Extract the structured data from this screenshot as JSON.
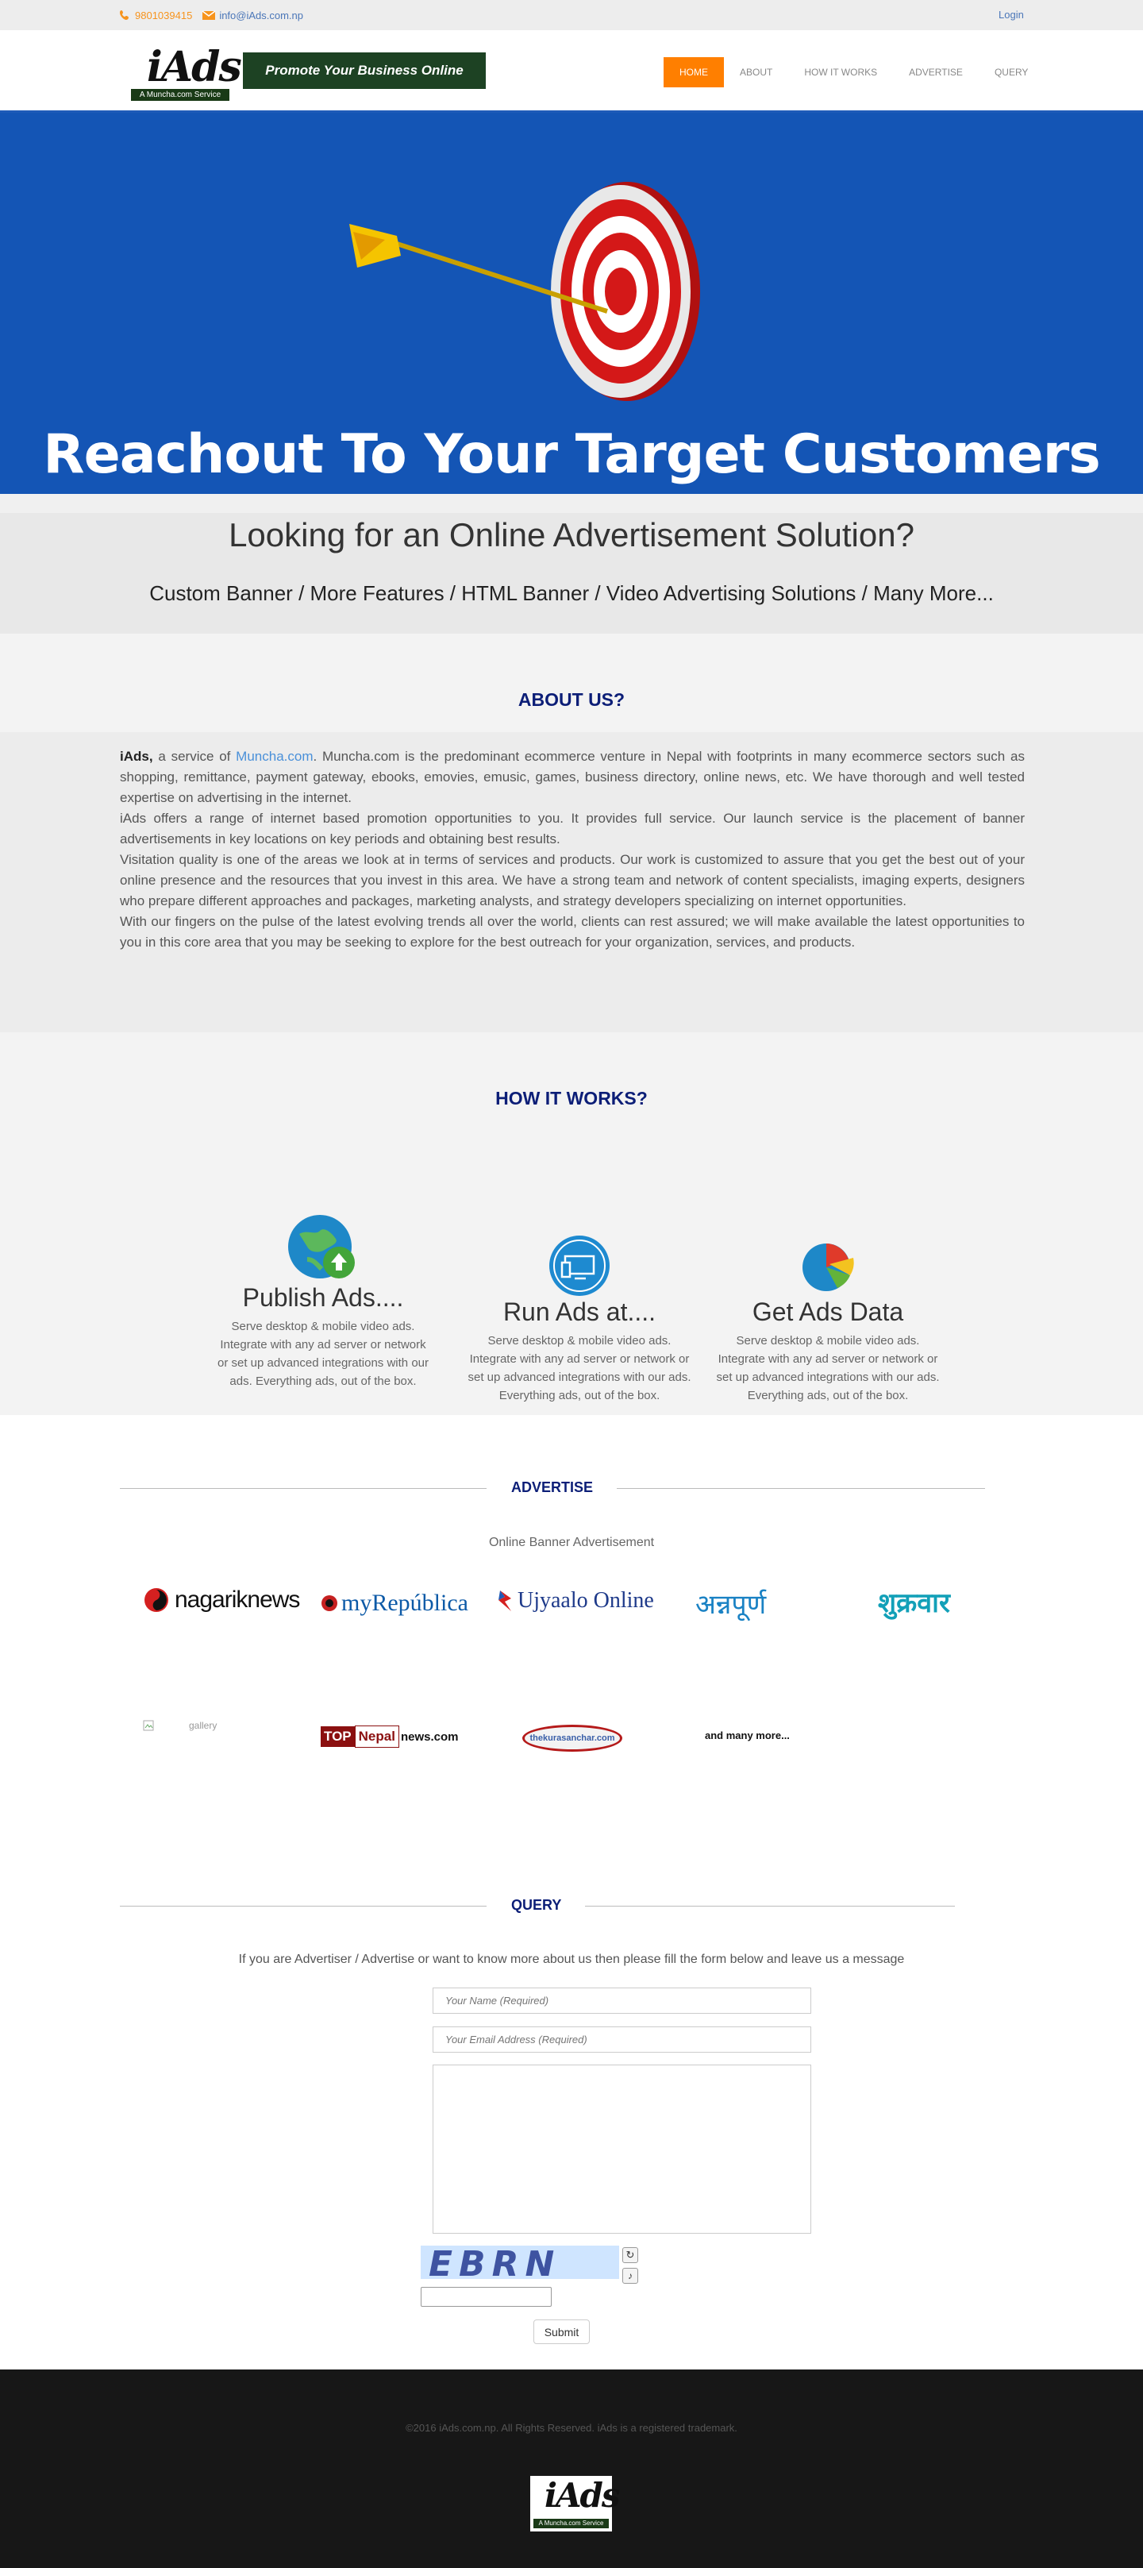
{
  "topbar": {
    "phone": "9801039415",
    "email": "info@iAds.com.np",
    "login": "Login"
  },
  "header": {
    "logo_text": "iAds",
    "logo_sub": "A Muncha.com Service",
    "promo": "Promote Your Business Online",
    "nav": [
      "HOME",
      "ABOUT",
      "HOW IT WORKS",
      "ADVERTISE",
      "QUERY"
    ],
    "nav_active": "HOME"
  },
  "hero": {
    "title": "Reachout To Your Target Customers",
    "bg_color": "#1455b5"
  },
  "looking": {
    "title": "Looking for an Online Advertisement Solution?",
    "subtitle": "Custom Banner / More Features / HTML Banner / Video Advertising Solutions / Many More..."
  },
  "about": {
    "title": "ABOUT US?",
    "brand": "iAds,",
    "p1_a": " a service of ",
    "p1_link": "Muncha.com",
    "p1_b": ". Muncha.com is the predominant ecommerce venture in Nepal with footprints in many ecommerce sectors such as shopping, remittance, payment gateway, ebooks, emovies, emusic, games, business directory, online news, etc. We have thorough and well tested expertise on advertising in the internet.",
    "p2": "iAds offers a range of internet based promotion opportunities to you. It provides full service. Our launch service is the placement of banner advertisements in key locations on key periods and obtaining best results.",
    "p3": "Visitation quality is one of the areas we look at in terms of services and products. Our work is customized to assure that you get the best out of your online presence and the resources that you invest in this area. We have a strong team and network of content specialists, imaging experts, designers who prepare different approaches and packages, marketing analysts, and strategy developers specializing on internet opportunities.",
    "p4": "With our fingers on the pulse of the latest evolving trends all over the world, clients can rest assured; we will make available the latest opportunities to you in this core area that you may be seeking to explore for the best outreach for your organization, services, and products."
  },
  "how": {
    "title": "HOW IT WORKS?",
    "cols": [
      {
        "heading": "Publish Ads....",
        "text": "Serve desktop & mobile video ads. Integrate with any ad server or network or set up advanced integrations with our ads. Everything ads, out of the box."
      },
      {
        "heading": "Run Ads at....",
        "text": "Serve desktop & mobile video ads. Integrate with any ad server or network or set up advanced integrations with our ads. Everything ads, out of the box."
      },
      {
        "heading": "Get Ads Data",
        "text": "Serve desktop & mobile video ads. Integrate with any ad server or network or set up advanced integrations with our ads. Everything ads, out of the box."
      }
    ]
  },
  "advertise": {
    "title": "ADVERTISE",
    "subtitle": "Online Banner Advertisement",
    "logos": [
      "nagariknews",
      "myRepública",
      "Ujyaalo Online",
      "अन्नपूर्ण",
      "शुक्रवार"
    ],
    "logos2_alt": "gallery",
    "top_nepal_a": "TOP",
    "top_nepal_b": "Nepal",
    "top_nepal_c": "news.com",
    "sanchar": "thekurasanchar.com",
    "more": "and many more..."
  },
  "query": {
    "title": "QUERY",
    "intro": "If you are Advertiser / Advertise or want to know more about us then please fill the form below and leave us a message",
    "name_placeholder": "Your Name (Required)",
    "email_placeholder": "Your Email Address (Required)",
    "captcha": "EBRN",
    "submit": "Submit"
  },
  "footer": {
    "copyright": "©2016 iAds.com.np. All Rights Reserved. iAds is a registered trademark.",
    "logo_text": "iAds",
    "logo_sub": "A Muncha.com Service"
  }
}
